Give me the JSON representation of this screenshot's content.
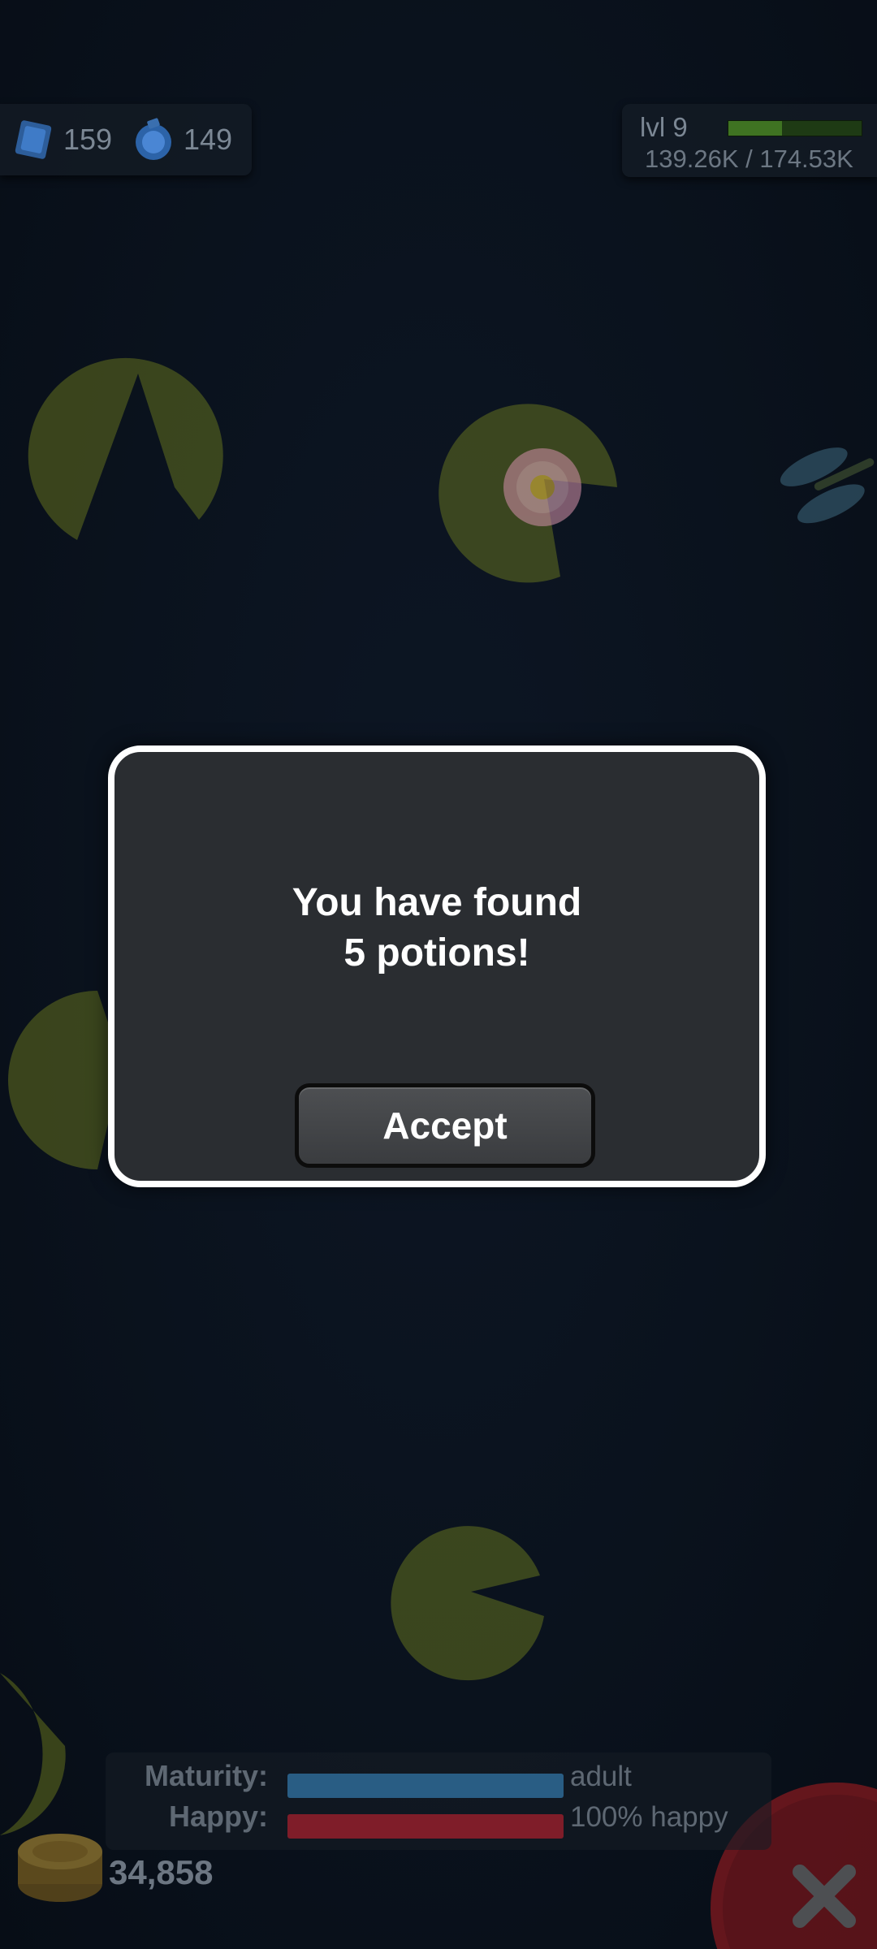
{
  "hud": {
    "gems": "159",
    "potions": "149",
    "level": "lvl 9",
    "xp_text": "139.26K / 174.53K",
    "xp_progress": 0.4
  },
  "dialog": {
    "line1": "You have found",
    "line2": "5 potions!",
    "accept_label": "Accept"
  },
  "status": {
    "maturity_label": "Maturity:",
    "maturity_value": "adult",
    "maturity_progress": 1.0,
    "happy_label": "Happy:",
    "happy_value": "100% happy",
    "happy_progress": 1.0,
    "coins": "34,858"
  },
  "icons": {
    "gem": "blue-gem-icon",
    "potion": "blue-potion-icon",
    "coins": "gold-coin-stack-icon",
    "close": "close-x-icon",
    "dragonfly": "dragonfly-icon",
    "lotus": "lotus-flower-icon"
  },
  "colors": {
    "maturity_bar": "#2f6f9e",
    "happy_bar": "#9b1f2c",
    "xp_bar": "#3f7322",
    "close_button": "#8c1a1f"
  }
}
